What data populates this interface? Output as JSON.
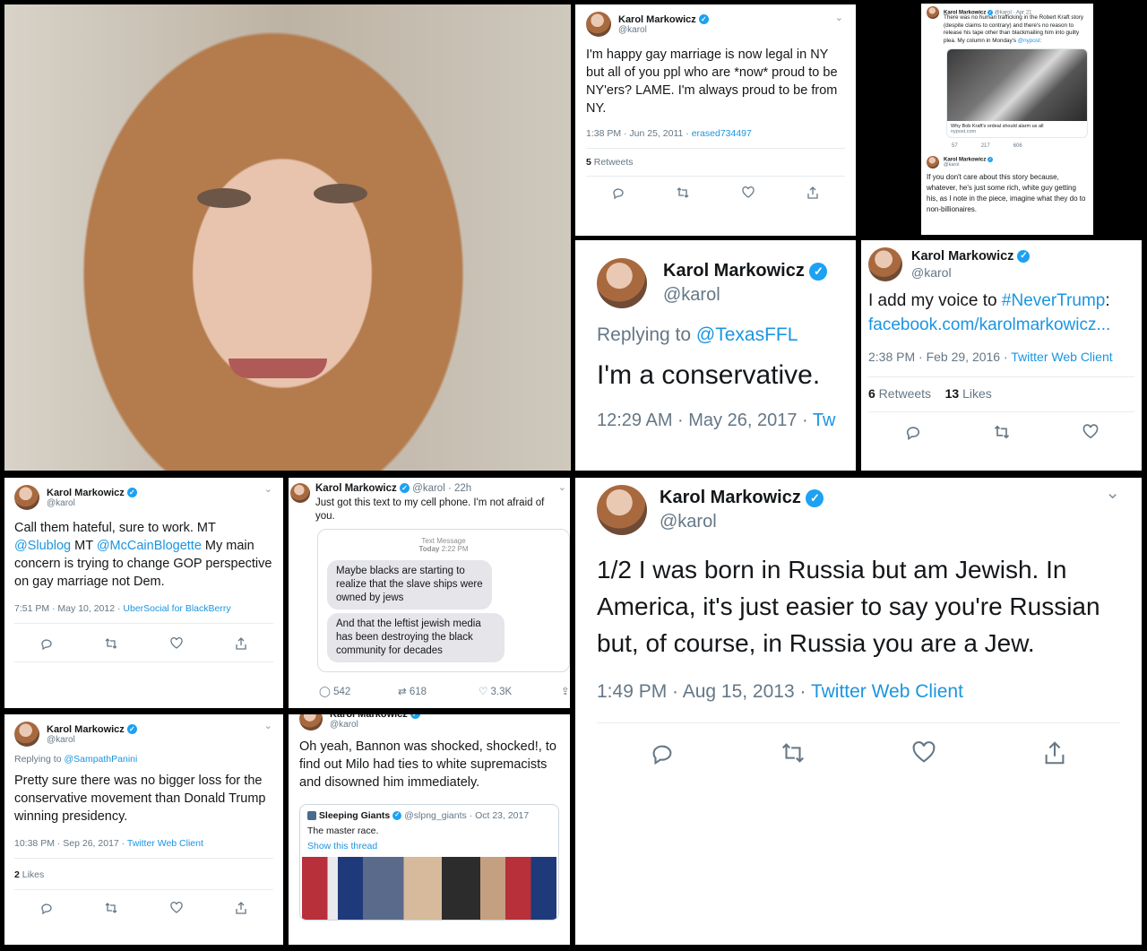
{
  "user": {
    "name": "Karol Markowicz",
    "handle": "@karol"
  },
  "tweet_ny": {
    "text": "I'm happy gay marriage is now legal in NY but all of you ppl who are *now* proud to be NY'ers? LAME.  I'm always proud to be from NY.",
    "time": "1:38 PM · Jun 25, 2011 · ",
    "source": "erased734497",
    "retweets_count": "5",
    "retweets_label": " Retweets"
  },
  "tweet_kraft": {
    "date": "· Apr 21",
    "text": "There was no human trafficking in the Robert Kraft story (despite claims to contrary) and there's no reason to release his tape other than blackmailing him into guilty plea. My column in Monday's",
    "link": "@nypost:",
    "card_title": "Why Bob Kraft's ordeal should alarm us all",
    "card_domain": "nypost.com",
    "replies": "57",
    "retweets": "217",
    "likes": "606",
    "reply_text": "If you don't care about this story because, whatever, he's just some rich, white guy getting his, as I note in the piece, imagine what they do to non-billionaires."
  },
  "tweet_conservative": {
    "replying_label": "Replying to ",
    "replying_to": "@TexasFFL",
    "text": "I'm a conservative.",
    "time": "12:29 AM · May 26, 2017 · ",
    "source": "Tw"
  },
  "tweet_nevertrump": {
    "text_pre": "I add my voice to ",
    "hashtag": "#NeverTrump",
    "text_post": ":",
    "link": "facebook.com/karolmarkowicz...",
    "time": "2:38 PM · Feb 29, 2016 · ",
    "source": "Twitter Web Client",
    "retweets_count": "6",
    "retweets_label": " Retweets",
    "likes_count": "13",
    "likes_label": " Likes"
  },
  "tweet_hateful": {
    "text_a": "Call them hateful, sure to work. MT ",
    "mention1": "@Slublog",
    "text_b": " MT ",
    "mention2": "@McCainBlogette",
    "text_c": " My main concern is trying to change GOP perspective on gay marriage not Dem.",
    "time": "7:51 PM · May 10, 2012 · ",
    "source": "UberSocial for BlackBerry"
  },
  "tweet_text_message": {
    "time_ago": "· 22h",
    "text": "Just got this text to my cell phone. I'm not afraid of you.",
    "sms_header": "Text Message",
    "sms_day": "Today",
    "sms_time": "2:22 PM",
    "bubble1": "Maybe blacks are starting to realize that the slave ships were owned by jews",
    "bubble2": "And that the leftist jewish media has been destroying the black community for decades",
    "replies": "542",
    "retweets": "618",
    "likes": "3.3K"
  },
  "tweet_russia": {
    "text": "1/2 I was born in Russia but am Jewish. In America, it's just easier to say you're Russian but, of course, in Russia you are a Jew.",
    "time": "1:49 PM · Aug 15, 2013 · ",
    "source": "Twitter Web Client"
  },
  "tweet_loss": {
    "replying_label": "Replying to ",
    "replying_to": "@SampathPanini",
    "text": "Pretty sure there was no bigger loss for the conservative movement than Donald Trump winning presidency.",
    "time": "10:38 PM · Sep 26, 2017 · ",
    "source": "Twitter Web Client",
    "likes_count": "2",
    "likes_label": " Likes"
  },
  "tweet_bannon": {
    "text": "Oh yeah, Bannon was shocked, shocked!, to find out Milo had ties to white supremacists and disowned him immediately.",
    "quote_name": "Sleeping Giants",
    "quote_handle": "@slpng_giants · Oct 23, 2017",
    "quote_text": "The master race.",
    "quote_link": "Show this thread"
  },
  "colors": {
    "link": "#1b95e0",
    "verified": "#1da1f2",
    "muted": "#657786",
    "bubble": "#e5e5ea"
  }
}
